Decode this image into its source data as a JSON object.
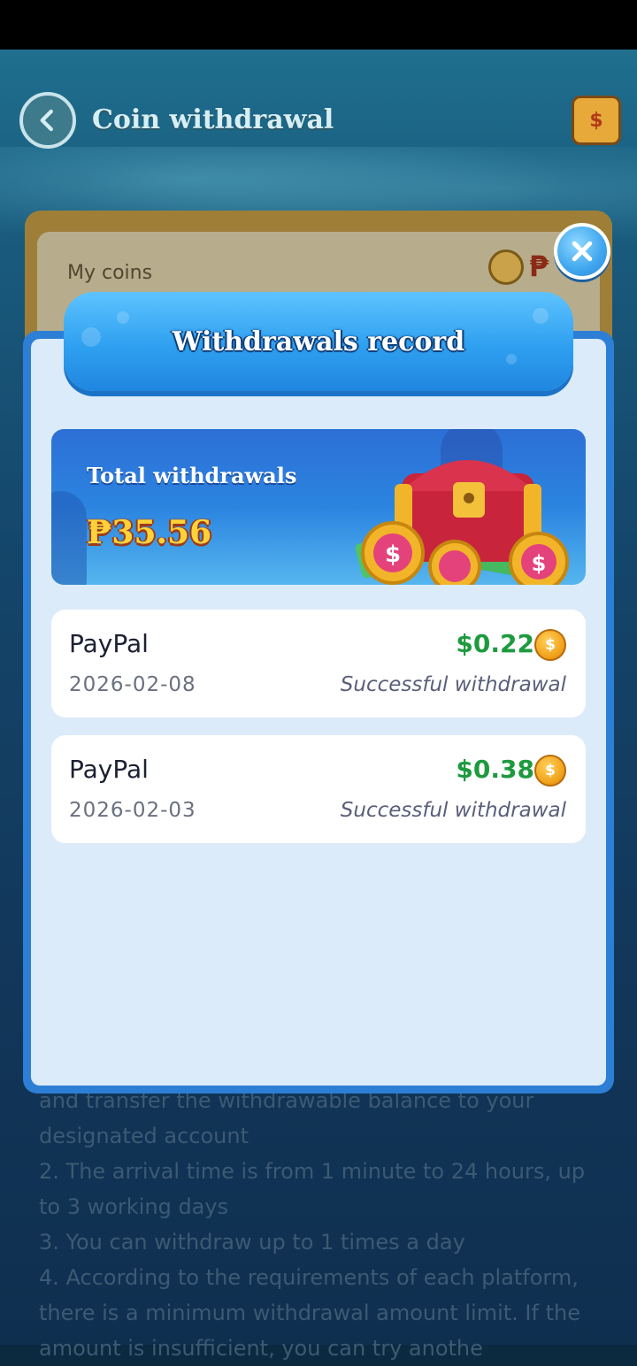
{
  "page": {
    "title": "Coin withdrawal",
    "my_coins_label": "My coins",
    "rules": [
      "and transfer the withdrawable balance to your",
      "designated account",
      "2. The arrival time is from 1 minute to 24 hours, up",
      "to 3 working days",
      "3. You can withdraw up to 1 times a day",
      "4. According to the requirements of each platform,",
      "there is a minimum withdrawal amount limit. If the",
      "amount is insufficient, you can try anothe"
    ]
  },
  "modal": {
    "title": "Withdrawals record",
    "banner": {
      "label": "Total withdrawals",
      "amount": "₱35.56"
    },
    "records": [
      {
        "method": "PayPal",
        "date": "2026-02-08",
        "amount": "$0.22",
        "status": "Successful withdrawal"
      },
      {
        "method": "PayPal",
        "date": "2026-02-03",
        "amount": "$0.38",
        "status": "Successful withdrawal"
      }
    ]
  },
  "colors": {
    "modal_border": "#2d7fd6",
    "modal_body": "#dcebf9",
    "amount_green": "#1d9a3e",
    "banner_amount": "#ffd23a"
  },
  "icons": {
    "back": "chevron-left-icon",
    "wallet": "wallet-icon",
    "close": "close-icon",
    "coin": "coin-icon"
  }
}
